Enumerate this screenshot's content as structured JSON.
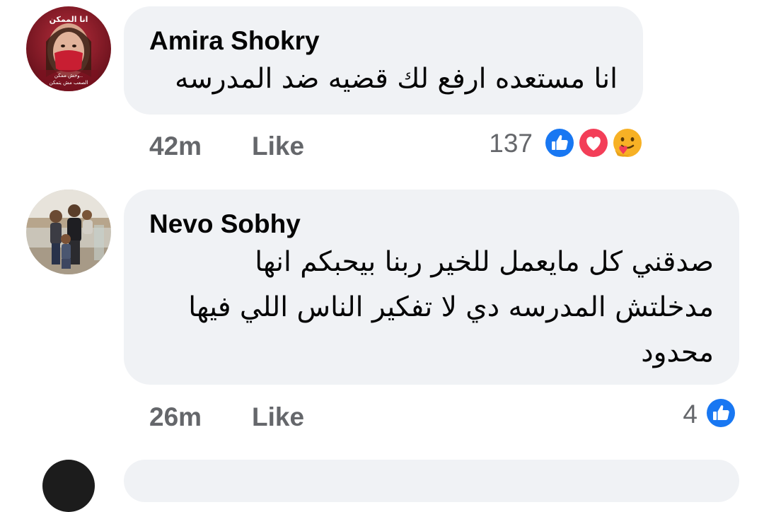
{
  "comments": [
    {
      "author": "Amira Shokry",
      "text_lines": [
        "انا مستعده ارفع لك قضيه ضد المدرسه"
      ],
      "time": "42m",
      "like_label": "Like",
      "reaction_count": "137",
      "reactions": [
        "like-icon",
        "love-icon",
        "care-icon"
      ],
      "avatar_text": {
        "top": "انا الممكن",
        "bottom_line1": "وحش ممكن..",
        "bottom_line2": "الصعب مش يتمكن"
      }
    },
    {
      "author": "Nevo Sobhy",
      "text_lines": [
        "صدقني كل مايعمل للخير ربنا بيحبكم انها",
        "مدخلتش المدرسه دي لا تفكير الناس اللي فيها",
        "محدود"
      ],
      "time": "26m",
      "like_label": "Like",
      "reaction_count": "4",
      "reactions": [
        "like-icon"
      ]
    }
  ],
  "colors": {
    "bubble": "#f0f2f5",
    "meta": "#65676b",
    "like_blue": "#1877f2",
    "love_red": "#f33e58",
    "care_yellow": "#f7b125"
  }
}
